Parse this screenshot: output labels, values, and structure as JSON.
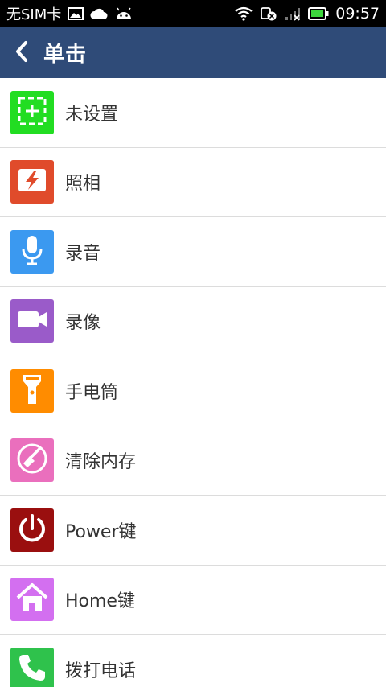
{
  "status_bar": {
    "carrier": "无SIM卡",
    "time": "09:57",
    "icons": [
      "image-icon",
      "cloud-icon",
      "android-icon",
      "wifi-icon",
      "sync-error-icon",
      "signal-off-icon",
      "battery-icon"
    ]
  },
  "header": {
    "back_icon": "chevron-left-icon",
    "title": "单击"
  },
  "colors": {
    "header_bg": "#2f4b78",
    "status_bg": "#000000",
    "divider": "#dcdcdc"
  },
  "items": [
    {
      "label": "未设置",
      "icon": "add-icon",
      "color": "#22dd22"
    },
    {
      "label": "照相",
      "icon": "flash-icon",
      "color": "#e04b2b"
    },
    {
      "label": "录音",
      "icon": "microphone-icon",
      "color": "#3b99f0"
    },
    {
      "label": "录像",
      "icon": "video-camera-icon",
      "color": "#9a5bc9"
    },
    {
      "label": "手电筒",
      "icon": "flashlight-icon",
      "color": "#ff8c00"
    },
    {
      "label": "清除内存",
      "icon": "broom-icon",
      "color": "#ea6fbd"
    },
    {
      "label": "Power键",
      "icon": "power-icon",
      "color": "#9a0f0f"
    },
    {
      "label": "Home键",
      "icon": "home-icon",
      "color": "#d36ff0"
    },
    {
      "label": "拨打电话",
      "icon": "phone-icon",
      "color": "#2fc24c"
    }
  ]
}
